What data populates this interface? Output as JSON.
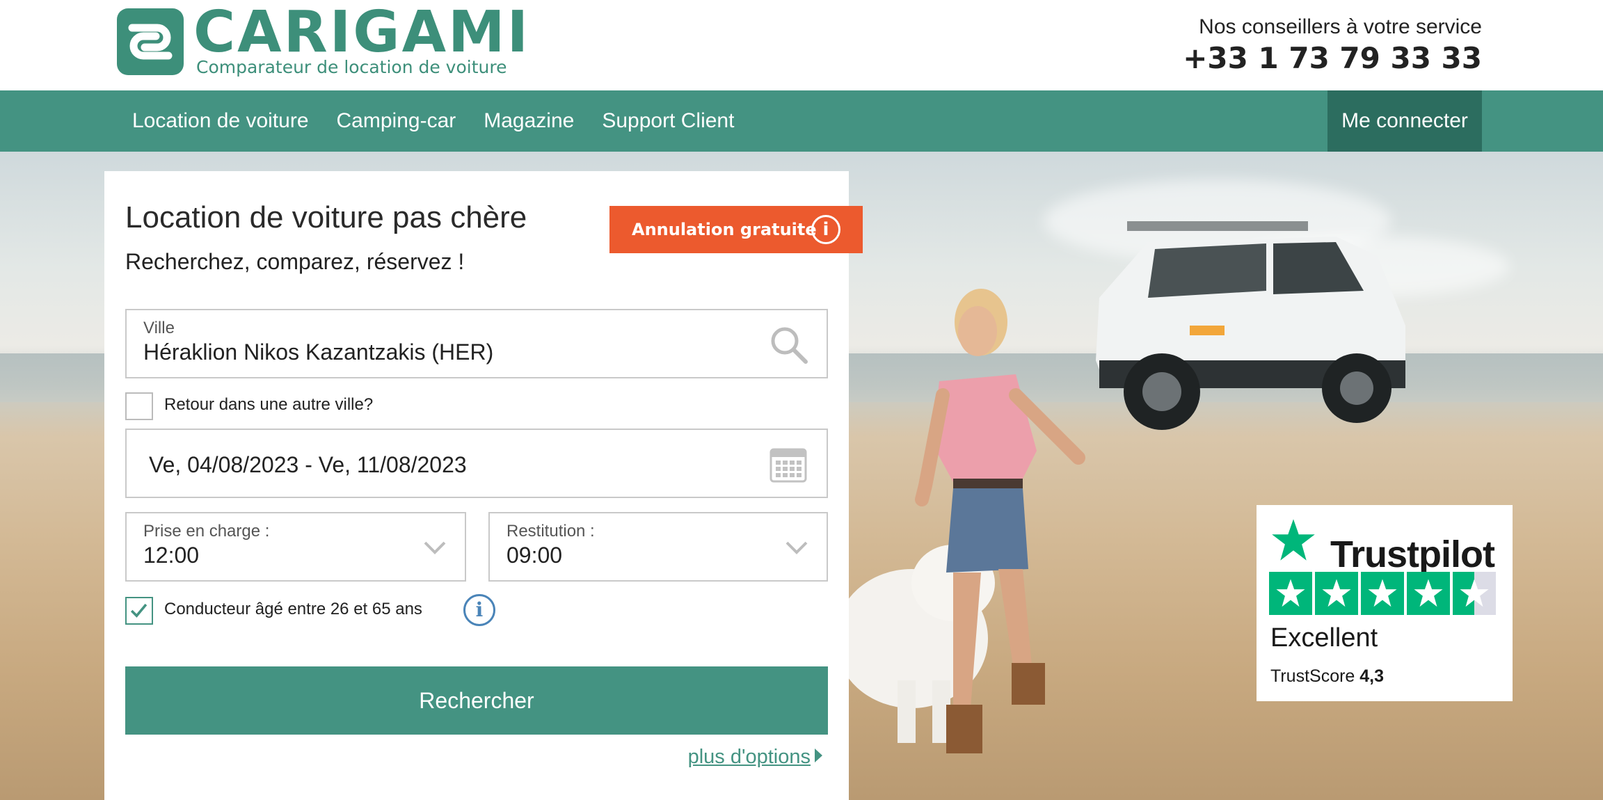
{
  "header": {
    "logo_text": "CARIGAMI",
    "logo_tagline": "Comparateur de location de voiture",
    "contact_label": "Nos conseillers à votre service",
    "phone": "+33 1 73 79 33 33"
  },
  "nav": {
    "items": [
      {
        "label": "Location de voiture"
      },
      {
        "label": "Camping-car"
      },
      {
        "label": "Magazine"
      },
      {
        "label": "Support Client"
      }
    ],
    "login_label": "Me connecter"
  },
  "search": {
    "title": "Location de voiture pas chère",
    "subtitle": "Recherchez, comparez, réservez !",
    "free_cancel_label": "Annulation gratuite",
    "city_label": "Ville",
    "city_value": "Héraklion Nikos Kazantzakis (HER)",
    "return_other_city_label": "Retour dans une autre ville?",
    "return_other_city_checked": false,
    "date_range": "Ve, 04/08/2023 - Ve, 11/08/2023",
    "pickup_label": "Prise en charge :",
    "pickup_time": "12:00",
    "dropoff_label": "Restitution :",
    "dropoff_time": "09:00",
    "driver_age_label": "Conducteur âgé entre 26 et 65 ans",
    "driver_age_checked": true,
    "search_button": "Rechercher",
    "more_options": "plus d'options"
  },
  "trustpilot": {
    "brand": "Trustpilot",
    "rating_text": "Excellent",
    "score_label": "TrustScore",
    "score_value": "4,3",
    "stars": 4.3
  },
  "colors": {
    "brand_green": "#449382",
    "login_dark_green": "#2c6d5f",
    "cancel_orange": "#ec5a2e",
    "trustpilot_green": "#00b67a",
    "info_blue": "#4a84b8"
  },
  "icons": {
    "logo": "carigami-logo-icon",
    "search": "search-icon",
    "calendar": "calendar-icon",
    "dropdown": "chevron-down-icon",
    "info": "info-icon",
    "check": "checkmark-icon",
    "trustpilot": "trustpilot-star-icon"
  }
}
